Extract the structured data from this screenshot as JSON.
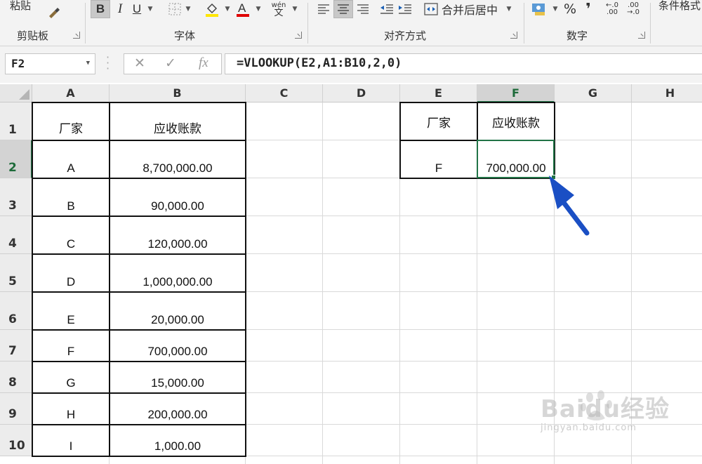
{
  "ribbon": {
    "groups": [
      {
        "label": "剪贴板"
      },
      {
        "label": "字体"
      },
      {
        "label": "对齐方式"
      },
      {
        "label": "数字"
      }
    ],
    "paste_label": "粘贴",
    "bold": "B",
    "italic": "I",
    "underline": "U",
    "phonetic_top": "wén",
    "phonetic_bottom": "文",
    "merge_label": "合并后居中",
    "percent": "%",
    "comma": "❜",
    "conditional_label": "条件格式"
  },
  "formula_bar": {
    "name_box": "F2",
    "fx": "fx",
    "formula": "=VLOOKUP(E2,A1:B10,2,0)"
  },
  "columns": [
    "A",
    "B",
    "C",
    "D",
    "E",
    "F",
    "G",
    "H"
  ],
  "rows": [
    "1",
    "2",
    "3",
    "4",
    "5",
    "6",
    "7",
    "8",
    "9",
    "10"
  ],
  "table_a": {
    "header_a": "厂家",
    "header_b": "应收账款",
    "rows": [
      {
        "a": "A",
        "b": "8,700,000.00"
      },
      {
        "a": "B",
        "b": "90,000.00"
      },
      {
        "a": "C",
        "b": "120,000.00"
      },
      {
        "a": "D",
        "b": "1,000,000.00"
      },
      {
        "a": "E",
        "b": "20,000.00"
      },
      {
        "a": "F",
        "b": "700,000.00"
      },
      {
        "a": "G",
        "b": "15,000.00"
      },
      {
        "a": "H",
        "b": "200,000.00"
      },
      {
        "a": "I",
        "b": "1,000.00"
      }
    ]
  },
  "lookup_table": {
    "header_e": "厂家",
    "header_f": "应收账款",
    "value_e": "F",
    "value_f": "700,000.00"
  },
  "watermark": {
    "main": "Baidu经验",
    "sub": "jingyan.baidu.com"
  },
  "colors": {
    "accent": "#217346",
    "arrow": "#1a4fc4"
  }
}
